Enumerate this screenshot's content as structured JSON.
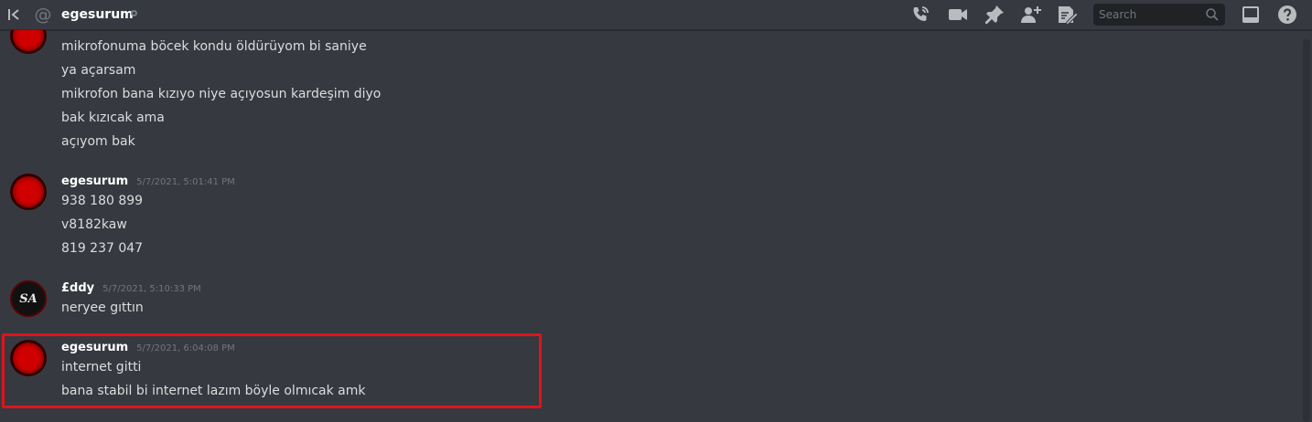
{
  "header": {
    "channel_name": "egesurum",
    "search_placeholder": "Search",
    "icons": [
      "collapse-icon",
      "at-sign-icon",
      "call-icon",
      "video-icon",
      "pin-icon",
      "add-friend-icon",
      "notes-icon",
      "search-icon",
      "inbox-icon",
      "help-icon"
    ]
  },
  "messages": [
    {
      "lines": [
        "mikrofonuma böcek kondu öldürüyom bi saniye",
        "ya açarsam",
        "mikrofon bana kızıyo niye açıyosun kardeşim diyo",
        "bak kızıcak ama",
        "açıyom bak"
      ]
    },
    {
      "author": "egesurum",
      "timestamp": "5/7/2021, 5:01:41 PM",
      "lines": [
        "938 180 899",
        "v8182kaw",
        "819 237 047"
      ]
    },
    {
      "author": "£ddy",
      "avatar_text": "SA",
      "timestamp": "5/7/2021, 5:10:33 PM",
      "lines": [
        "neryee gıttın"
      ]
    },
    {
      "author": "egesurum",
      "timestamp": "5/7/2021, 6:04:08 PM",
      "lines": [
        "internet gitti",
        "bana stabil bi internet lazım böyle olmıcak amk"
      ]
    }
  ],
  "colors": {
    "background": "#36393f",
    "highlight_border": "#e0131d",
    "avatar_red": "#d10000"
  }
}
